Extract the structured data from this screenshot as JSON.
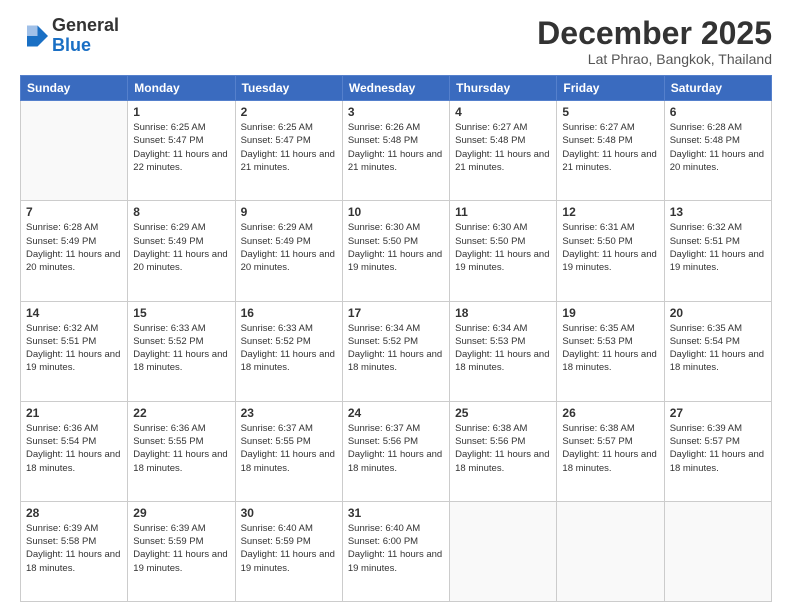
{
  "header": {
    "logo_general": "General",
    "logo_blue": "Blue",
    "month_title": "December 2025",
    "location": "Lat Phrao, Bangkok, Thailand"
  },
  "weekdays": [
    "Sunday",
    "Monday",
    "Tuesday",
    "Wednesday",
    "Thursday",
    "Friday",
    "Saturday"
  ],
  "weeks": [
    [
      {
        "day": "",
        "sunrise": "",
        "sunset": "",
        "daylight": ""
      },
      {
        "day": "1",
        "sunrise": "Sunrise: 6:25 AM",
        "sunset": "Sunset: 5:47 PM",
        "daylight": "Daylight: 11 hours and 22 minutes."
      },
      {
        "day": "2",
        "sunrise": "Sunrise: 6:25 AM",
        "sunset": "Sunset: 5:47 PM",
        "daylight": "Daylight: 11 hours and 21 minutes."
      },
      {
        "day": "3",
        "sunrise": "Sunrise: 6:26 AM",
        "sunset": "Sunset: 5:48 PM",
        "daylight": "Daylight: 11 hours and 21 minutes."
      },
      {
        "day": "4",
        "sunrise": "Sunrise: 6:27 AM",
        "sunset": "Sunset: 5:48 PM",
        "daylight": "Daylight: 11 hours and 21 minutes."
      },
      {
        "day": "5",
        "sunrise": "Sunrise: 6:27 AM",
        "sunset": "Sunset: 5:48 PM",
        "daylight": "Daylight: 11 hours and 21 minutes."
      },
      {
        "day": "6",
        "sunrise": "Sunrise: 6:28 AM",
        "sunset": "Sunset: 5:48 PM",
        "daylight": "Daylight: 11 hours and 20 minutes."
      }
    ],
    [
      {
        "day": "7",
        "sunrise": "Sunrise: 6:28 AM",
        "sunset": "Sunset: 5:49 PM",
        "daylight": "Daylight: 11 hours and 20 minutes."
      },
      {
        "day": "8",
        "sunrise": "Sunrise: 6:29 AM",
        "sunset": "Sunset: 5:49 PM",
        "daylight": "Daylight: 11 hours and 20 minutes."
      },
      {
        "day": "9",
        "sunrise": "Sunrise: 6:29 AM",
        "sunset": "Sunset: 5:49 PM",
        "daylight": "Daylight: 11 hours and 20 minutes."
      },
      {
        "day": "10",
        "sunrise": "Sunrise: 6:30 AM",
        "sunset": "Sunset: 5:50 PM",
        "daylight": "Daylight: 11 hours and 19 minutes."
      },
      {
        "day": "11",
        "sunrise": "Sunrise: 6:30 AM",
        "sunset": "Sunset: 5:50 PM",
        "daylight": "Daylight: 11 hours and 19 minutes."
      },
      {
        "day": "12",
        "sunrise": "Sunrise: 6:31 AM",
        "sunset": "Sunset: 5:50 PM",
        "daylight": "Daylight: 11 hours and 19 minutes."
      },
      {
        "day": "13",
        "sunrise": "Sunrise: 6:32 AM",
        "sunset": "Sunset: 5:51 PM",
        "daylight": "Daylight: 11 hours and 19 minutes."
      }
    ],
    [
      {
        "day": "14",
        "sunrise": "Sunrise: 6:32 AM",
        "sunset": "Sunset: 5:51 PM",
        "daylight": "Daylight: 11 hours and 19 minutes."
      },
      {
        "day": "15",
        "sunrise": "Sunrise: 6:33 AM",
        "sunset": "Sunset: 5:52 PM",
        "daylight": "Daylight: 11 hours and 18 minutes."
      },
      {
        "day": "16",
        "sunrise": "Sunrise: 6:33 AM",
        "sunset": "Sunset: 5:52 PM",
        "daylight": "Daylight: 11 hours and 18 minutes."
      },
      {
        "day": "17",
        "sunrise": "Sunrise: 6:34 AM",
        "sunset": "Sunset: 5:52 PM",
        "daylight": "Daylight: 11 hours and 18 minutes."
      },
      {
        "day": "18",
        "sunrise": "Sunrise: 6:34 AM",
        "sunset": "Sunset: 5:53 PM",
        "daylight": "Daylight: 11 hours and 18 minutes."
      },
      {
        "day": "19",
        "sunrise": "Sunrise: 6:35 AM",
        "sunset": "Sunset: 5:53 PM",
        "daylight": "Daylight: 11 hours and 18 minutes."
      },
      {
        "day": "20",
        "sunrise": "Sunrise: 6:35 AM",
        "sunset": "Sunset: 5:54 PM",
        "daylight": "Daylight: 11 hours and 18 minutes."
      }
    ],
    [
      {
        "day": "21",
        "sunrise": "Sunrise: 6:36 AM",
        "sunset": "Sunset: 5:54 PM",
        "daylight": "Daylight: 11 hours and 18 minutes."
      },
      {
        "day": "22",
        "sunrise": "Sunrise: 6:36 AM",
        "sunset": "Sunset: 5:55 PM",
        "daylight": "Daylight: 11 hours and 18 minutes."
      },
      {
        "day": "23",
        "sunrise": "Sunrise: 6:37 AM",
        "sunset": "Sunset: 5:55 PM",
        "daylight": "Daylight: 11 hours and 18 minutes."
      },
      {
        "day": "24",
        "sunrise": "Sunrise: 6:37 AM",
        "sunset": "Sunset: 5:56 PM",
        "daylight": "Daylight: 11 hours and 18 minutes."
      },
      {
        "day": "25",
        "sunrise": "Sunrise: 6:38 AM",
        "sunset": "Sunset: 5:56 PM",
        "daylight": "Daylight: 11 hours and 18 minutes."
      },
      {
        "day": "26",
        "sunrise": "Sunrise: 6:38 AM",
        "sunset": "Sunset: 5:57 PM",
        "daylight": "Daylight: 11 hours and 18 minutes."
      },
      {
        "day": "27",
        "sunrise": "Sunrise: 6:39 AM",
        "sunset": "Sunset: 5:57 PM",
        "daylight": "Daylight: 11 hours and 18 minutes."
      }
    ],
    [
      {
        "day": "28",
        "sunrise": "Sunrise: 6:39 AM",
        "sunset": "Sunset: 5:58 PM",
        "daylight": "Daylight: 11 hours and 18 minutes."
      },
      {
        "day": "29",
        "sunrise": "Sunrise: 6:39 AM",
        "sunset": "Sunset: 5:59 PM",
        "daylight": "Daylight: 11 hours and 19 minutes."
      },
      {
        "day": "30",
        "sunrise": "Sunrise: 6:40 AM",
        "sunset": "Sunset: 5:59 PM",
        "daylight": "Daylight: 11 hours and 19 minutes."
      },
      {
        "day": "31",
        "sunrise": "Sunrise: 6:40 AM",
        "sunset": "Sunset: 6:00 PM",
        "daylight": "Daylight: 11 hours and 19 minutes."
      },
      {
        "day": "",
        "sunrise": "",
        "sunset": "",
        "daylight": ""
      },
      {
        "day": "",
        "sunrise": "",
        "sunset": "",
        "daylight": ""
      },
      {
        "day": "",
        "sunrise": "",
        "sunset": "",
        "daylight": ""
      }
    ]
  ]
}
